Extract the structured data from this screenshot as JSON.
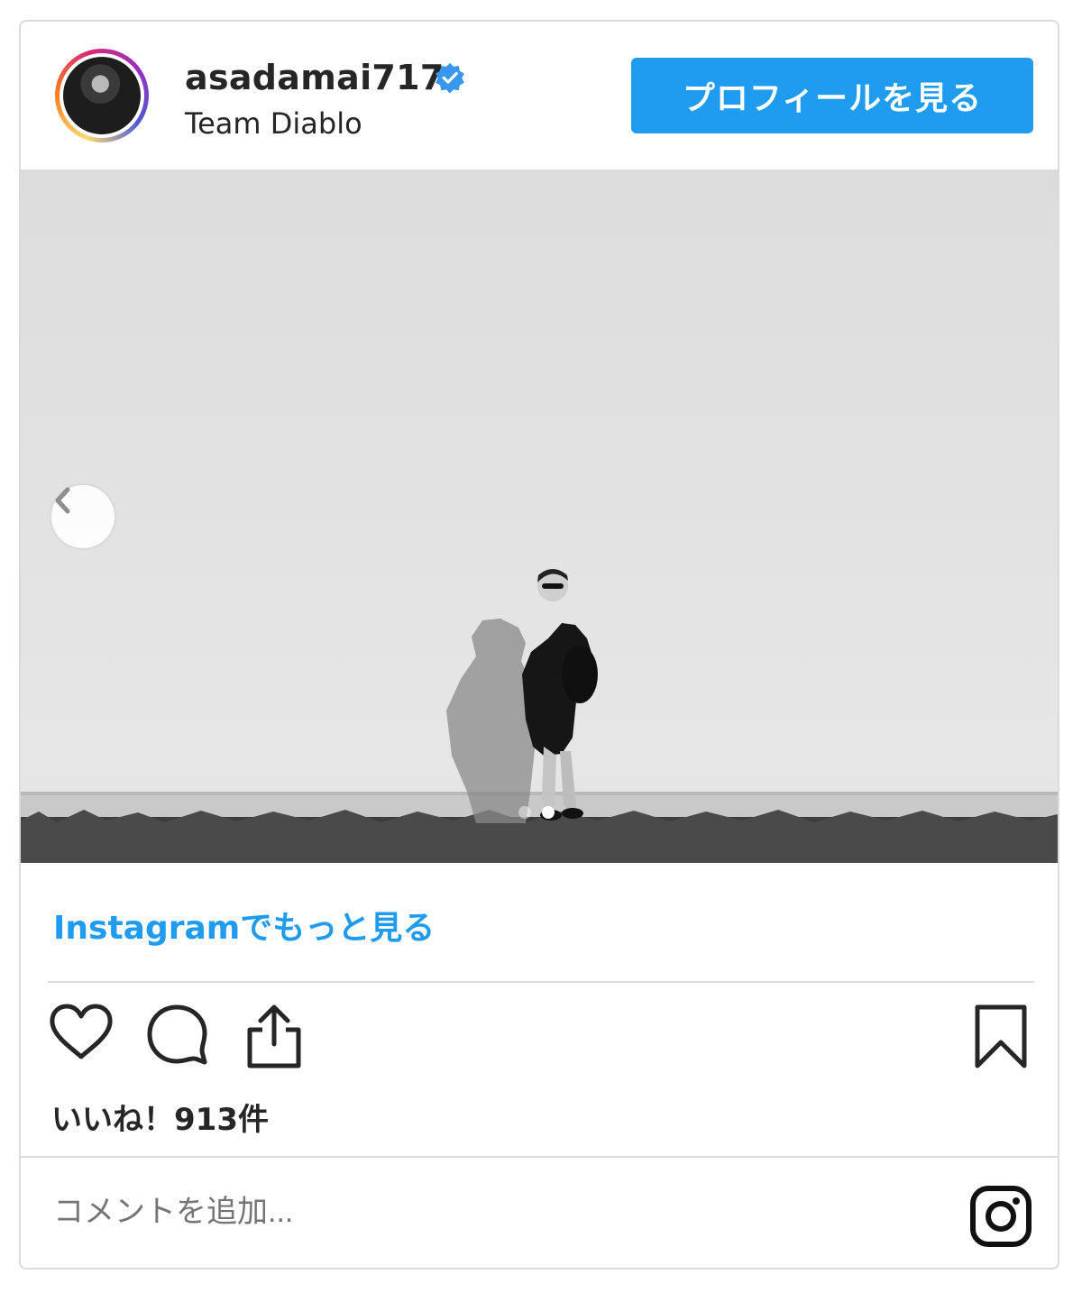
{
  "header": {
    "username": "asadamai717",
    "subtitle": "Team Diablo",
    "verified": true,
    "profile_button_label": "プロフィールを見る"
  },
  "post": {
    "carousel": {
      "total": 2,
      "current": 2
    },
    "more_link": "Instagramでもっと見る",
    "likes_text": "いいね！913件"
  },
  "comment": {
    "placeholder": "コメントを追加..."
  },
  "icons": {
    "like": "heart-icon",
    "comment": "comment-icon",
    "share": "share-icon",
    "save": "bookmark-icon",
    "carousel_prev": "chevron-left-icon",
    "brand": "instagram-icon",
    "verified": "verified-badge-icon"
  },
  "colors": {
    "accent_blue": "#1f9bf0",
    "text": "#262626",
    "muted": "#8e8e8e",
    "border": "#dbdbdb"
  }
}
